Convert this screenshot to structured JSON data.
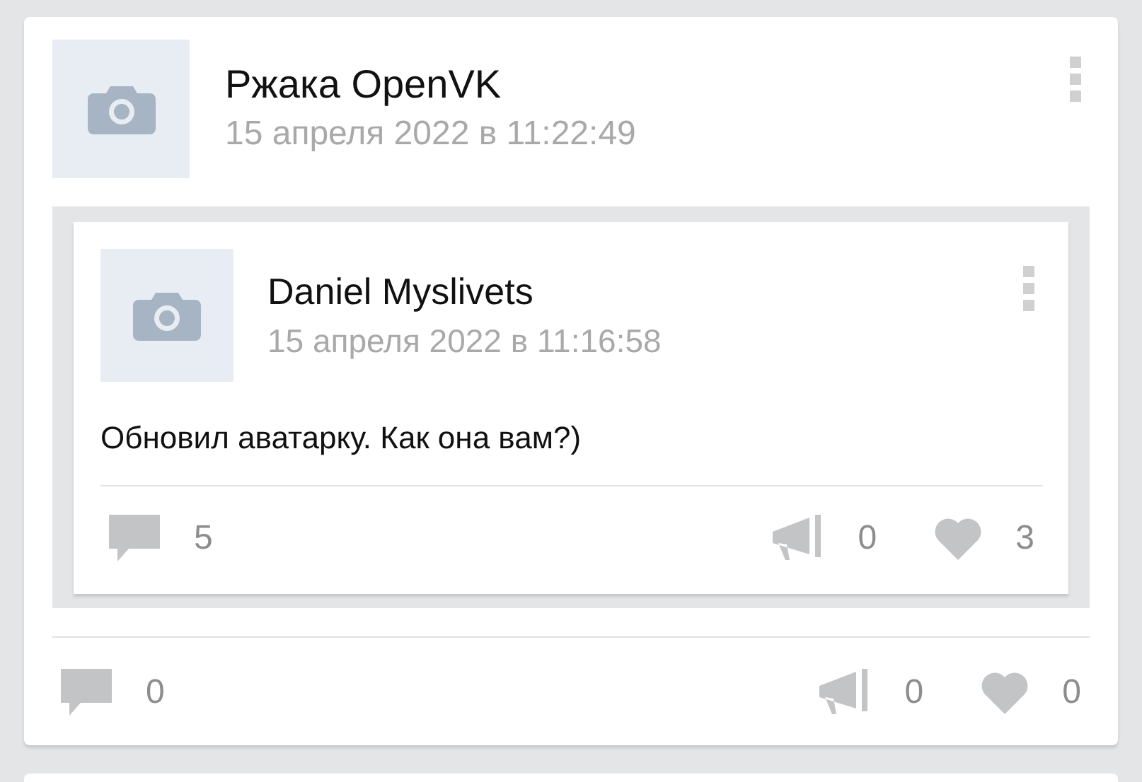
{
  "post": {
    "author": "Ржака OpenVK",
    "date": "15 апреля 2022 в 11:22:49",
    "repost": {
      "author": "Daniel Myslivets",
      "date": "15 апреля 2022 в 11:16:58",
      "text": "Обновил аватарку. Как она вам?)",
      "comments": "5",
      "reposts": "0",
      "likes": "3"
    },
    "comments": "0",
    "reposts": "0",
    "likes": "0"
  }
}
